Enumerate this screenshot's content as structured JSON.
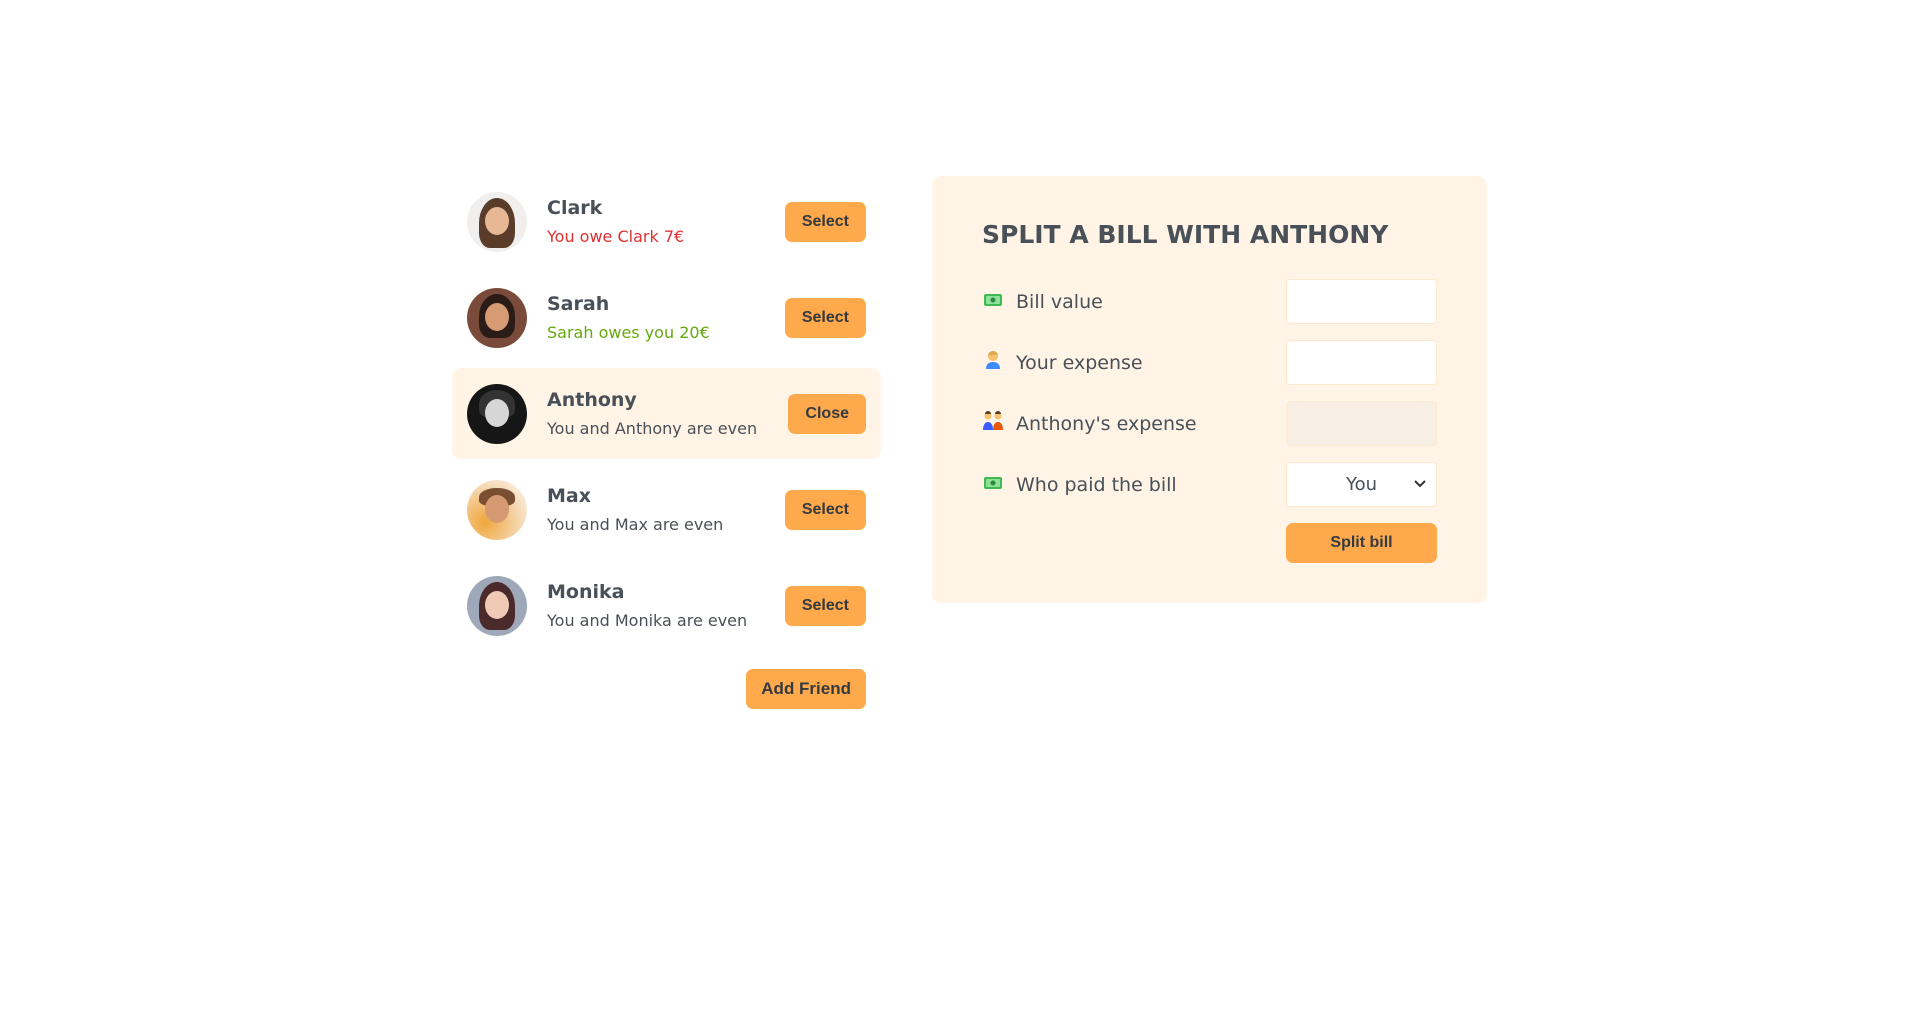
{
  "friends": [
    {
      "name": "Clark",
      "balance": "You owe Clark 7€",
      "action": "Select"
    },
    {
      "name": "Sarah",
      "balance": "Sarah owes you 20€",
      "action": "Select"
    },
    {
      "name": "Anthony",
      "balance": "You and Anthony are even",
      "action": "Close"
    },
    {
      "name": "Max",
      "balance": "You and Max are even",
      "action": "Select"
    },
    {
      "name": "Monika",
      "balance": "You and Monika are even",
      "action": "Select"
    }
  ],
  "add_friend_label": "Add Friend",
  "form": {
    "title": "Split a bill with Anthony",
    "bill_label": "Bill value",
    "bill_value": "",
    "bill_icon": "money-emoji",
    "your_expense_label": "Your expense",
    "your_expense_value": "",
    "your_expense_icon": "person-emoji",
    "friend_expense_label": "Anthony's expense",
    "friend_expense_value": "",
    "friend_expense_icon": "couple-emoji",
    "who_paid_label": "Who paid the bill",
    "who_paid_icon": "money-emoji",
    "who_paid_selected": "You",
    "submit_label": "Split bill"
  },
  "colors": {
    "accent": "#ffa94d",
    "panel": "#fff4e6",
    "owe": "#e03131",
    "owed": "#66a80f"
  }
}
